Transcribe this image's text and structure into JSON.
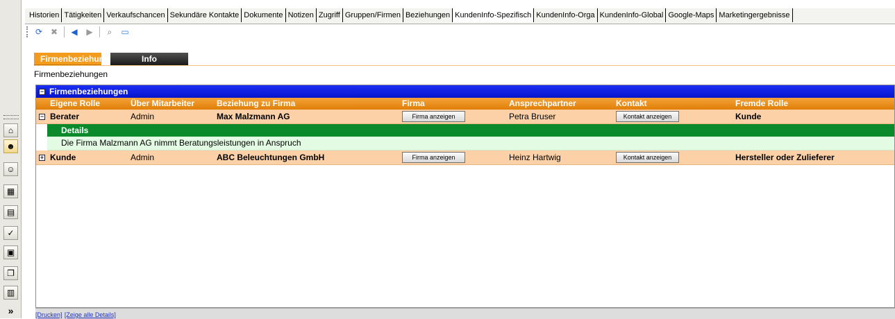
{
  "tabs": [
    {
      "label": "Historien",
      "active": false
    },
    {
      "label": "Tätigkeiten",
      "active": false
    },
    {
      "label": "Verkaufschancen",
      "active": false
    },
    {
      "label": "Sekundäre Kontakte",
      "active": false
    },
    {
      "label": "Dokumente",
      "active": false
    },
    {
      "label": "Notizen",
      "active": false
    },
    {
      "label": "Zugriff",
      "active": false
    },
    {
      "label": "Gruppen/Firmen",
      "active": false
    },
    {
      "label": "Beziehungen",
      "active": false
    },
    {
      "label": "KundenInfo-Spezifisch",
      "active": true
    },
    {
      "label": "KundenInfo-Orga",
      "active": false
    },
    {
      "label": "KundenInfo-Global",
      "active": false
    },
    {
      "label": "Google-Maps",
      "active": false
    },
    {
      "label": "Marketingergebnisse",
      "active": false
    }
  ],
  "toolbar_icons": [
    "refresh-icon",
    "delete-icon",
    "back-icon",
    "forward-icon",
    "preview-icon",
    "window-icon"
  ],
  "subtabs": {
    "firmenbeziehungen": "Firmenbeziehungen",
    "info": "Info"
  },
  "section_label": "Firmenbeziehungen",
  "grid": {
    "group_title": "Firmenbeziehungen",
    "columns": [
      "Eigene Rolle",
      "Über Mitarbeiter",
      "Beziehung zu Firma",
      "Firma",
      "Ansprechpartner",
      "Kontakt",
      "Fremde Rolle"
    ],
    "rows": [
      {
        "rolle": "Berater",
        "mitarbeiter": "Admin",
        "firma": "Max Malzmann AG",
        "firma_btn": "Firma anzeigen",
        "ansprechpartner": "Petra Bruser",
        "kontakt_btn": "Kontakt anzeigen",
        "fremde_rolle": "Kunde",
        "expand": "−",
        "details_title": "Details",
        "details_text": "Die Firma Malzmann AG nimmt Beratungsleistungen in Anspruch"
      },
      {
        "rolle": "Kunde",
        "mitarbeiter": "Admin",
        "firma": "ABC Beleuchtungen GmbH",
        "firma_btn": "Firma anzeigen",
        "ansprechpartner": "Heinz Hartwig",
        "kontakt_btn": "Kontakt anzeigen",
        "fremde_rolle": "Hersteller oder Zulieferer",
        "expand": "+"
      }
    ]
  },
  "footer": {
    "print": "[Drucken]",
    "show_all": "[Zeige alle Details]"
  },
  "colors": {
    "group_header": "#0614c9",
    "column_header": "#e07f06",
    "row": "#fcd1a7",
    "details_header": "#0b8a2c",
    "details_body": "#e3fae3"
  }
}
